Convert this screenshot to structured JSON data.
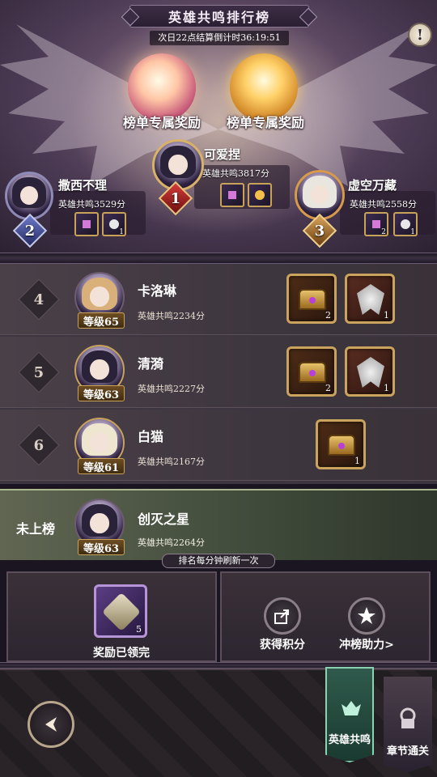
{
  "header": {
    "title": "英雄共鸣排行榜",
    "timer": "次日22点结算倒计时36:19:51"
  },
  "rewards_banner": [
    {
      "label": "榜单专属奖励"
    },
    {
      "label": "榜单专属奖励"
    }
  ],
  "top3": [
    {
      "rank": "1",
      "name": "可爱捏",
      "score": "英雄共鸣3817分",
      "items": [
        {
          "count": ""
        },
        {
          "count": ""
        }
      ]
    },
    {
      "rank": "2",
      "name": "撒西不理",
      "score": "英雄共鸣3529分",
      "items": [
        {
          "count": ""
        },
        {
          "count": "1"
        }
      ]
    },
    {
      "rank": "3",
      "name": "虚空万藏",
      "score": "英雄共鸣2558分",
      "items": [
        {
          "count": "2"
        },
        {
          "count": "1"
        }
      ]
    }
  ],
  "list": [
    {
      "rank": "4",
      "name": "卡洛琳",
      "level": "等级65",
      "score": "英雄共鸣2234分",
      "rewards": [
        {
          "type": "chest",
          "count": "2"
        },
        {
          "type": "crest",
          "count": "1"
        }
      ]
    },
    {
      "rank": "5",
      "name": "清漪",
      "level": "等级63",
      "score": "英雄共鸣2227分",
      "rewards": [
        {
          "type": "chest",
          "count": "2"
        },
        {
          "type": "crest",
          "count": "1"
        }
      ]
    },
    {
      "rank": "6",
      "name": "白猫",
      "level": "等级61",
      "score": "英雄共鸣2167分",
      "rewards": [
        {
          "type": "chest",
          "count": "1"
        }
      ]
    }
  ],
  "me": {
    "rank_text": "未上榜",
    "name": "创灭之星",
    "level": "等级63",
    "score": "英雄共鸣2264分"
  },
  "refresh_note": "排名每分钟刷新一次",
  "claim": {
    "label": "奖励已领完",
    "count": "5"
  },
  "actions": [
    {
      "label": "获得积分",
      "icon": "share-icon"
    },
    {
      "label": "冲榜助力>",
      "icon": "boost-icon"
    }
  ],
  "nav": [
    {
      "label": "英雄共鸣",
      "active": true
    },
    {
      "label": "章节通关",
      "active": false
    }
  ],
  "colors": {
    "accent_gold": "#c9a25a",
    "my_row": "#4f5a46",
    "active_tab": "#2f5a4c"
  }
}
